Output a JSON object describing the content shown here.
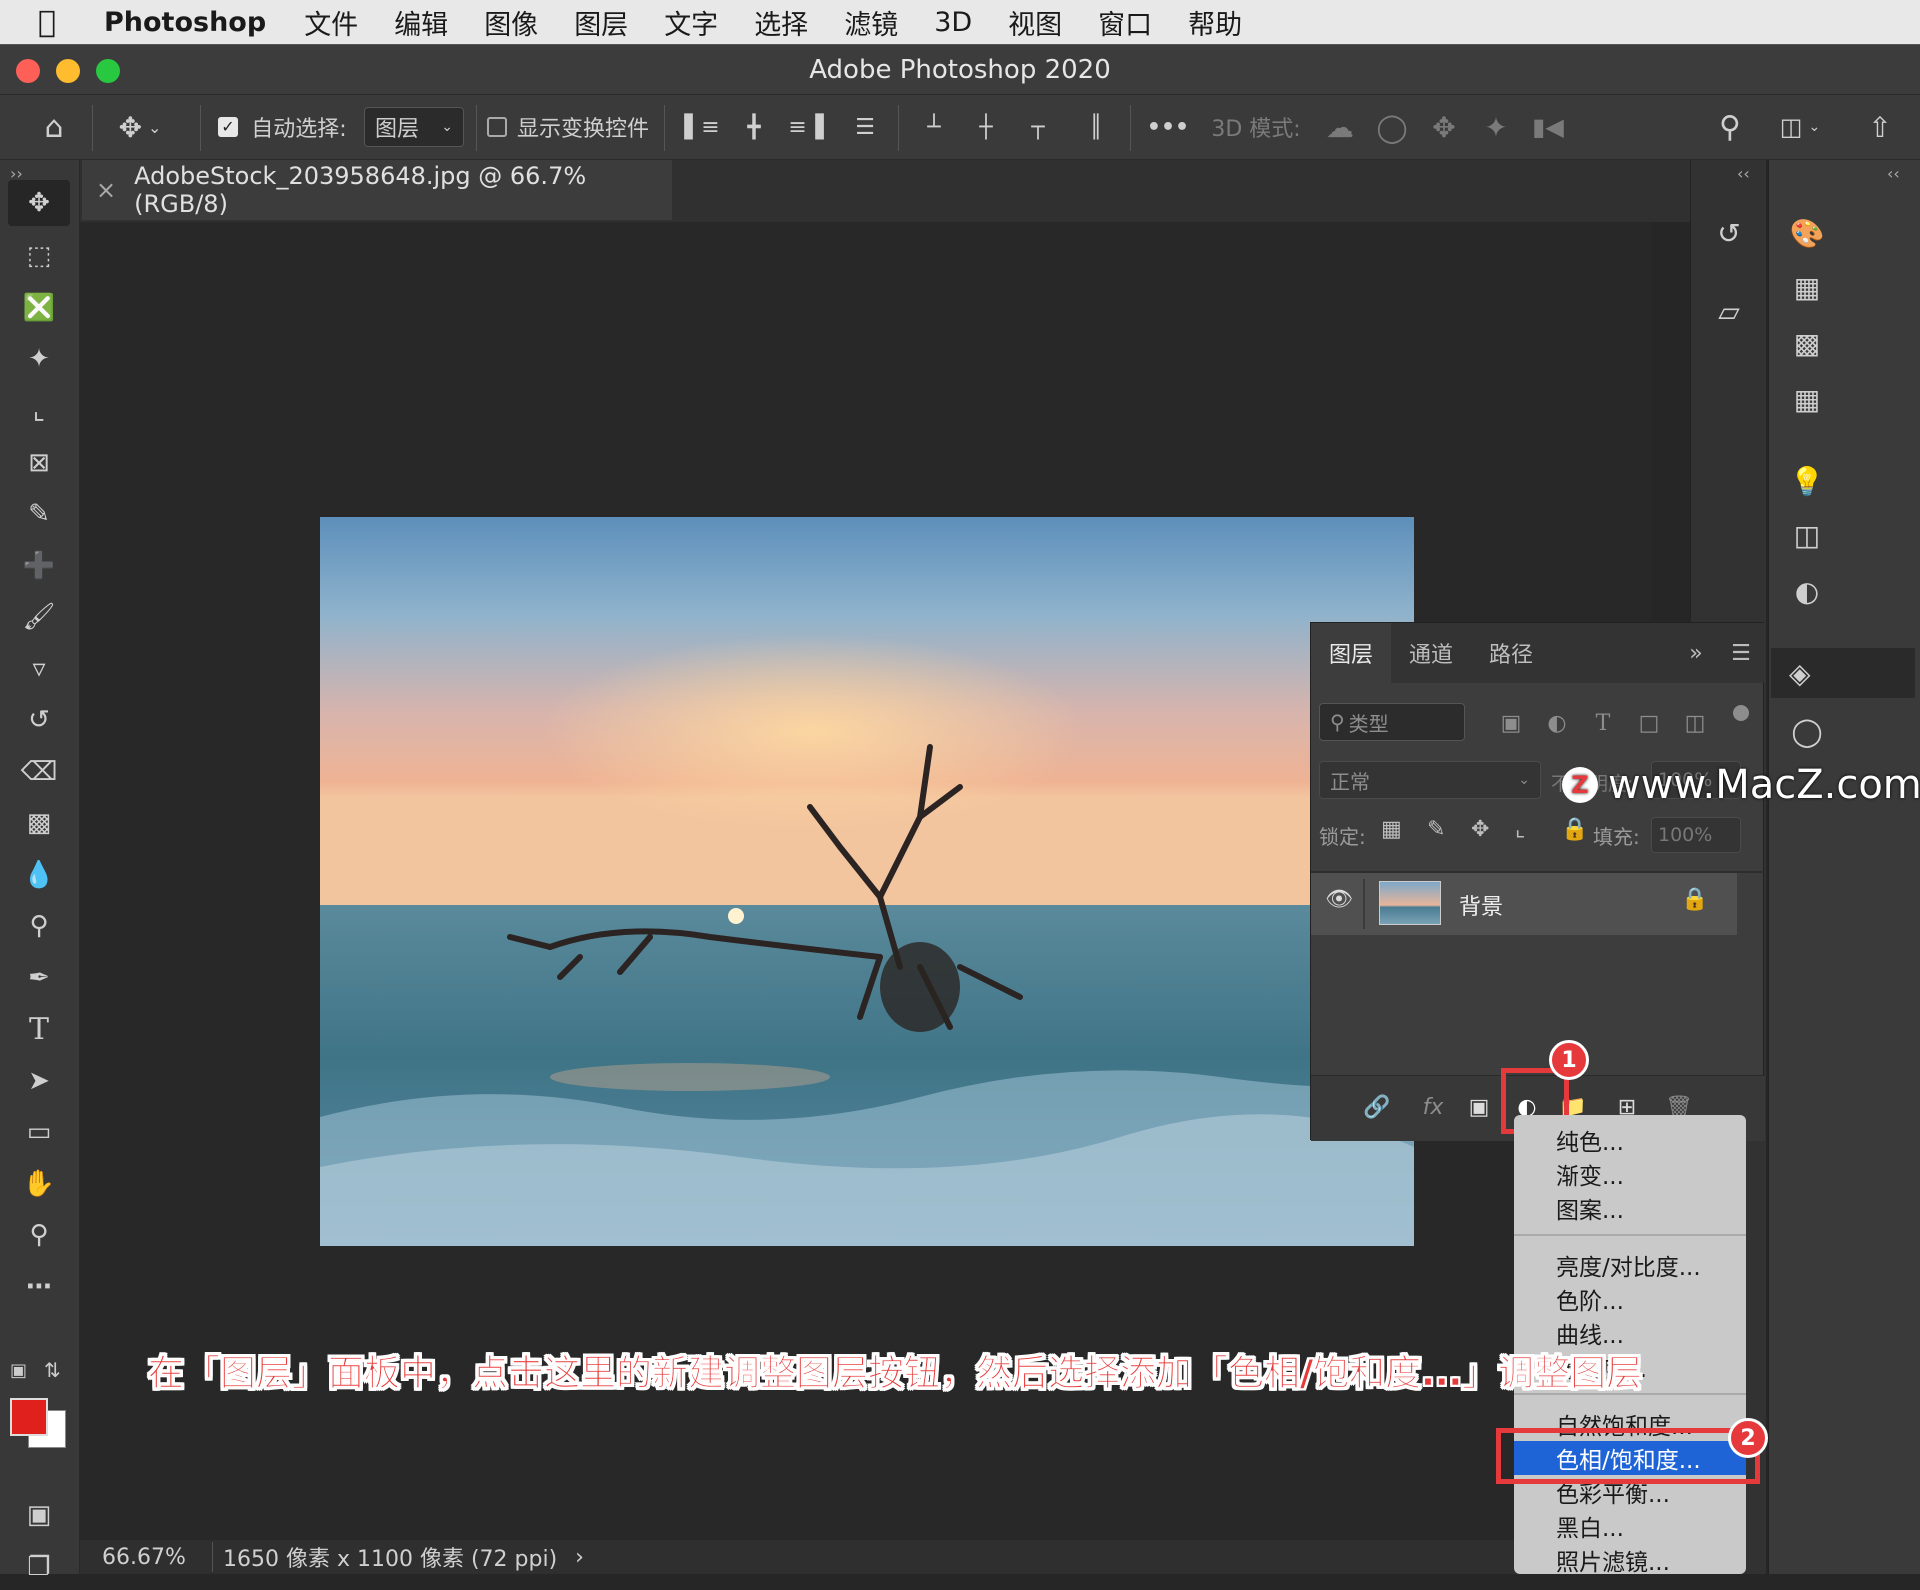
{
  "menubar": {
    "app": "Photoshop",
    "items": [
      "文件",
      "编辑",
      "图像",
      "图层",
      "文字",
      "选择",
      "滤镜",
      "3D",
      "视图",
      "窗口",
      "帮助"
    ]
  },
  "window": {
    "title": "Adobe Photoshop 2020"
  },
  "options": {
    "auto_select_label": "自动选择:",
    "auto_select_value": "图层",
    "show_transform_label": "显示变换控件",
    "more": "•••",
    "mode_3d_label": "3D 模式:"
  },
  "doc_tab": {
    "close": "×",
    "label": "AdobeStock_203958648.jpg @ 66.7%(RGB/8)"
  },
  "panel_collapse": {
    "left": "››",
    "right1": "‹‹",
    "right2": "‹‹"
  },
  "layers_panel": {
    "tabs": [
      "图层",
      "通道",
      "路径"
    ],
    "filter_placeholder": "类型",
    "blend_mode": "正常",
    "opacity_label": "不透明度:",
    "opacity_value": "100%",
    "lock_label": "锁定:",
    "fill_label": "填充:",
    "fill_value": "100%",
    "layer_name": "背景"
  },
  "status": {
    "zoom": "66.67%",
    "info": "1650 像素 x 1100 像素 (72 ppi)",
    "arrow": "›"
  },
  "adjust_menu": {
    "group1": [
      "纯色...",
      "渐变...",
      "图案..."
    ],
    "group2": [
      "亮度/对比度...",
      "色阶...",
      "曲线...",
      "曝光度..."
    ],
    "group3": [
      "自然饱和度...",
      "色相/饱和度...",
      "色彩平衡...",
      "黑白...",
      "照片滤镜..."
    ]
  },
  "annotations": {
    "badge1": "1",
    "badge2": "2",
    "caption": "在「图层」面板中，点击这里的新建调整图层按钮，然后选择添加「色相/饱和度...」调整图层",
    "watermark": "www.MacZ.com",
    "watermark_logo": "Z"
  },
  "colors": {
    "accent": "#1f64d6",
    "annotation_red": "#e6393c",
    "foreground": "#e0201c",
    "background": "#ffffff"
  }
}
